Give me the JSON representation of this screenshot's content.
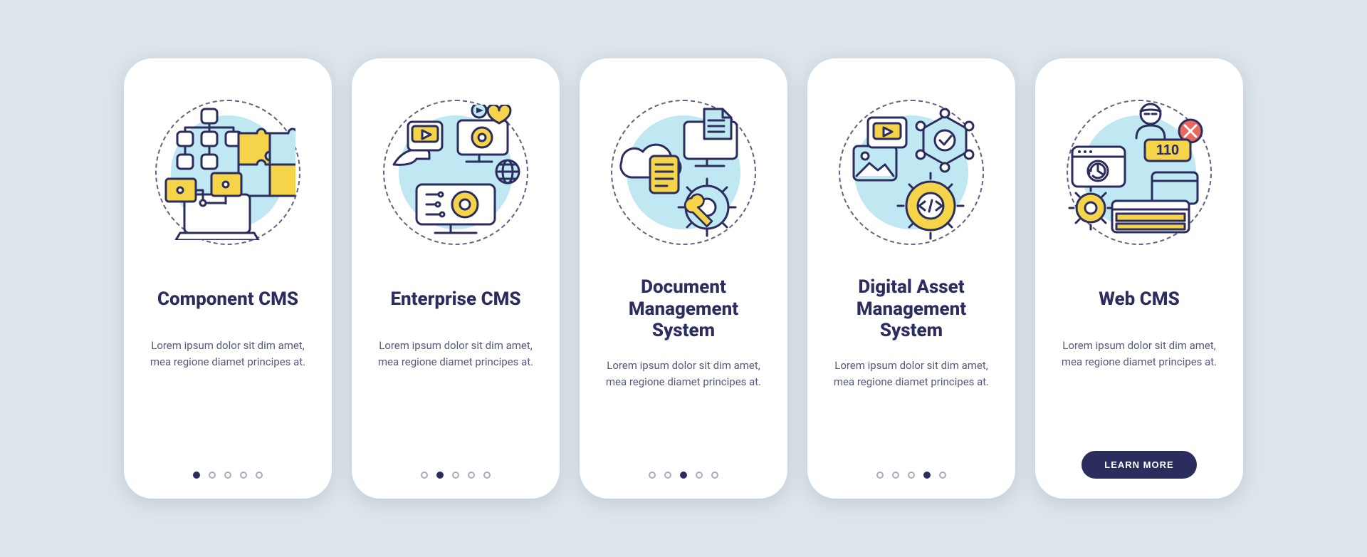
{
  "colors": {
    "navy": "#2b2d5e",
    "yellow": "#f6d449",
    "cyan": "#bfe8f2",
    "stroke": "#2b2d5e"
  },
  "cards": [
    {
      "title": "Component CMS",
      "desc": "Lorem ipsum dolor sit dim amet, mea regione diamet principes at.",
      "icon": "component-cms-illustration",
      "activeDot": 0,
      "cta": null
    },
    {
      "title": "Enterprise CMS",
      "desc": "Lorem ipsum dolor sit dim amet, mea regione diamet principes at.",
      "icon": "enterprise-cms-illustration",
      "activeDot": 1,
      "cta": null
    },
    {
      "title": "Document Management System",
      "desc": "Lorem ipsum dolor sit dim amet, mea regione diamet principes at.",
      "icon": "document-management-illustration",
      "activeDot": 2,
      "cta": null
    },
    {
      "title": "Digital Asset Management System",
      "desc": "Lorem ipsum dolor sit dim amet, mea regione diamet principes at.",
      "icon": "digital-asset-illustration",
      "activeDot": 3,
      "cta": null
    },
    {
      "title": "Web CMS",
      "desc": "Lorem ipsum dolor sit dim amet, mea regione diamet principes at.",
      "icon": "web-cms-illustration",
      "activeDot": 4,
      "cta": "LEARN MORE"
    }
  ],
  "dotCount": 5,
  "binaryLabel": "110"
}
